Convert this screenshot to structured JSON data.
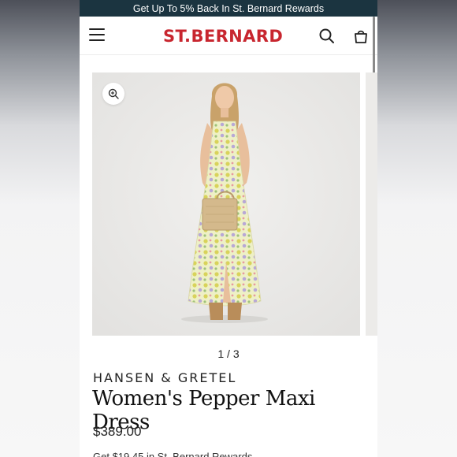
{
  "promo_banner": {
    "text": "Get Up To 5% Back In St. Bernard Rewards"
  },
  "header": {
    "logo_text": "ST.BERNARD",
    "icons": [
      "menu-icon",
      "search-icon",
      "bag-icon"
    ],
    "brand_color": "#c8262f"
  },
  "gallery": {
    "image_counter": "1 / 3",
    "zoom_icon": "zoom-in-icon",
    "image_subject": "model-in-floral-maxi-dress-icon"
  },
  "product": {
    "brand": "HANSEN & GRETEL",
    "title": "Women's Pepper Maxi Dress",
    "price": "$389.00",
    "rewards_text": "Get $19.45 in St. Bernard Rewards"
  },
  "colors": {
    "promo_background": "#1b3440",
    "logo": "#c8262f",
    "image_background": "#ecebe9"
  }
}
